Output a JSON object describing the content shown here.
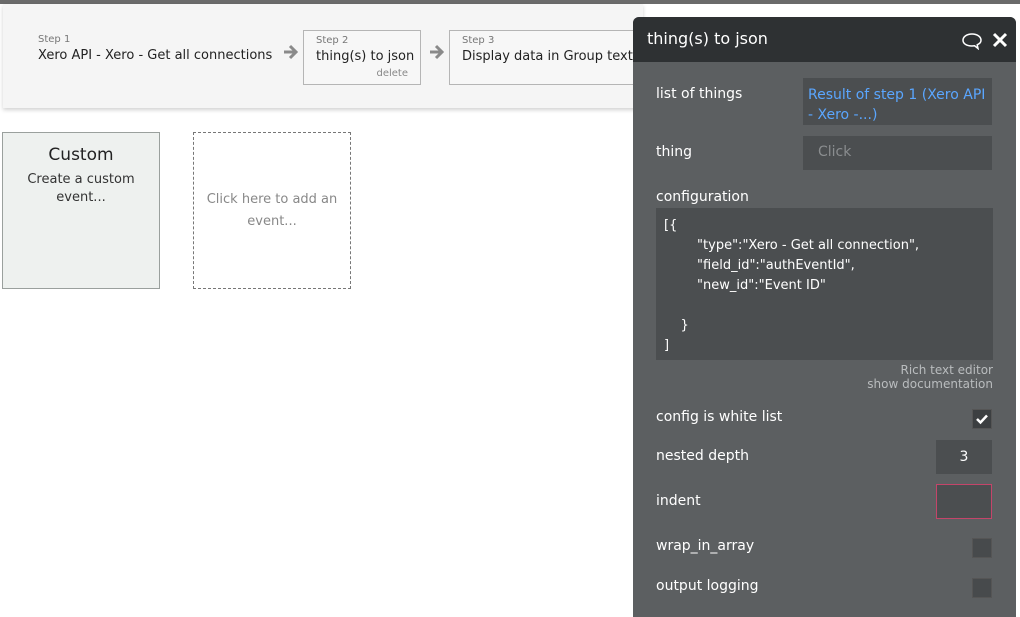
{
  "workflow": {
    "steps": [
      {
        "number": "Step 1",
        "label": "Xero API - Xero - Get all connections"
      },
      {
        "number": "Step 2",
        "label": "thing(s) to json",
        "delete": "delete"
      },
      {
        "number": "Step 3",
        "label": "Display data in Group text"
      }
    ]
  },
  "events": {
    "custom": {
      "title": "Custom",
      "description": "Create a custom event..."
    },
    "add": {
      "text": "Click here to add an event..."
    }
  },
  "panel": {
    "title": "thing(s) to json",
    "icons": {
      "comment": "comment-icon",
      "close": "close-icon"
    },
    "fields": {
      "list_of_things": {
        "label": "list of things",
        "value": "Result of step 1 (Xero API - Xero -...)"
      },
      "thing": {
        "label": "thing",
        "placeholder": "Click"
      },
      "configuration": {
        "label": "configuration",
        "value": "[{\n        \"type\":\"Xero - Get all connection\",\n        \"field_id\":\"authEventId\",\n        \"new_id\":\"Event ID\"\n\n    }\n]"
      },
      "rich_text_editor": "Rich text editor",
      "show_documentation": "show documentation",
      "config_is_white_list": {
        "label": "config is white list",
        "checked": true
      },
      "nested_depth": {
        "label": "nested depth",
        "value": "3"
      },
      "indent": {
        "label": "indent",
        "value": ""
      },
      "wrap_in_array": {
        "label": "wrap_in_array",
        "checked": false
      },
      "output_logging": {
        "label": "output logging",
        "checked": false
      }
    }
  }
}
